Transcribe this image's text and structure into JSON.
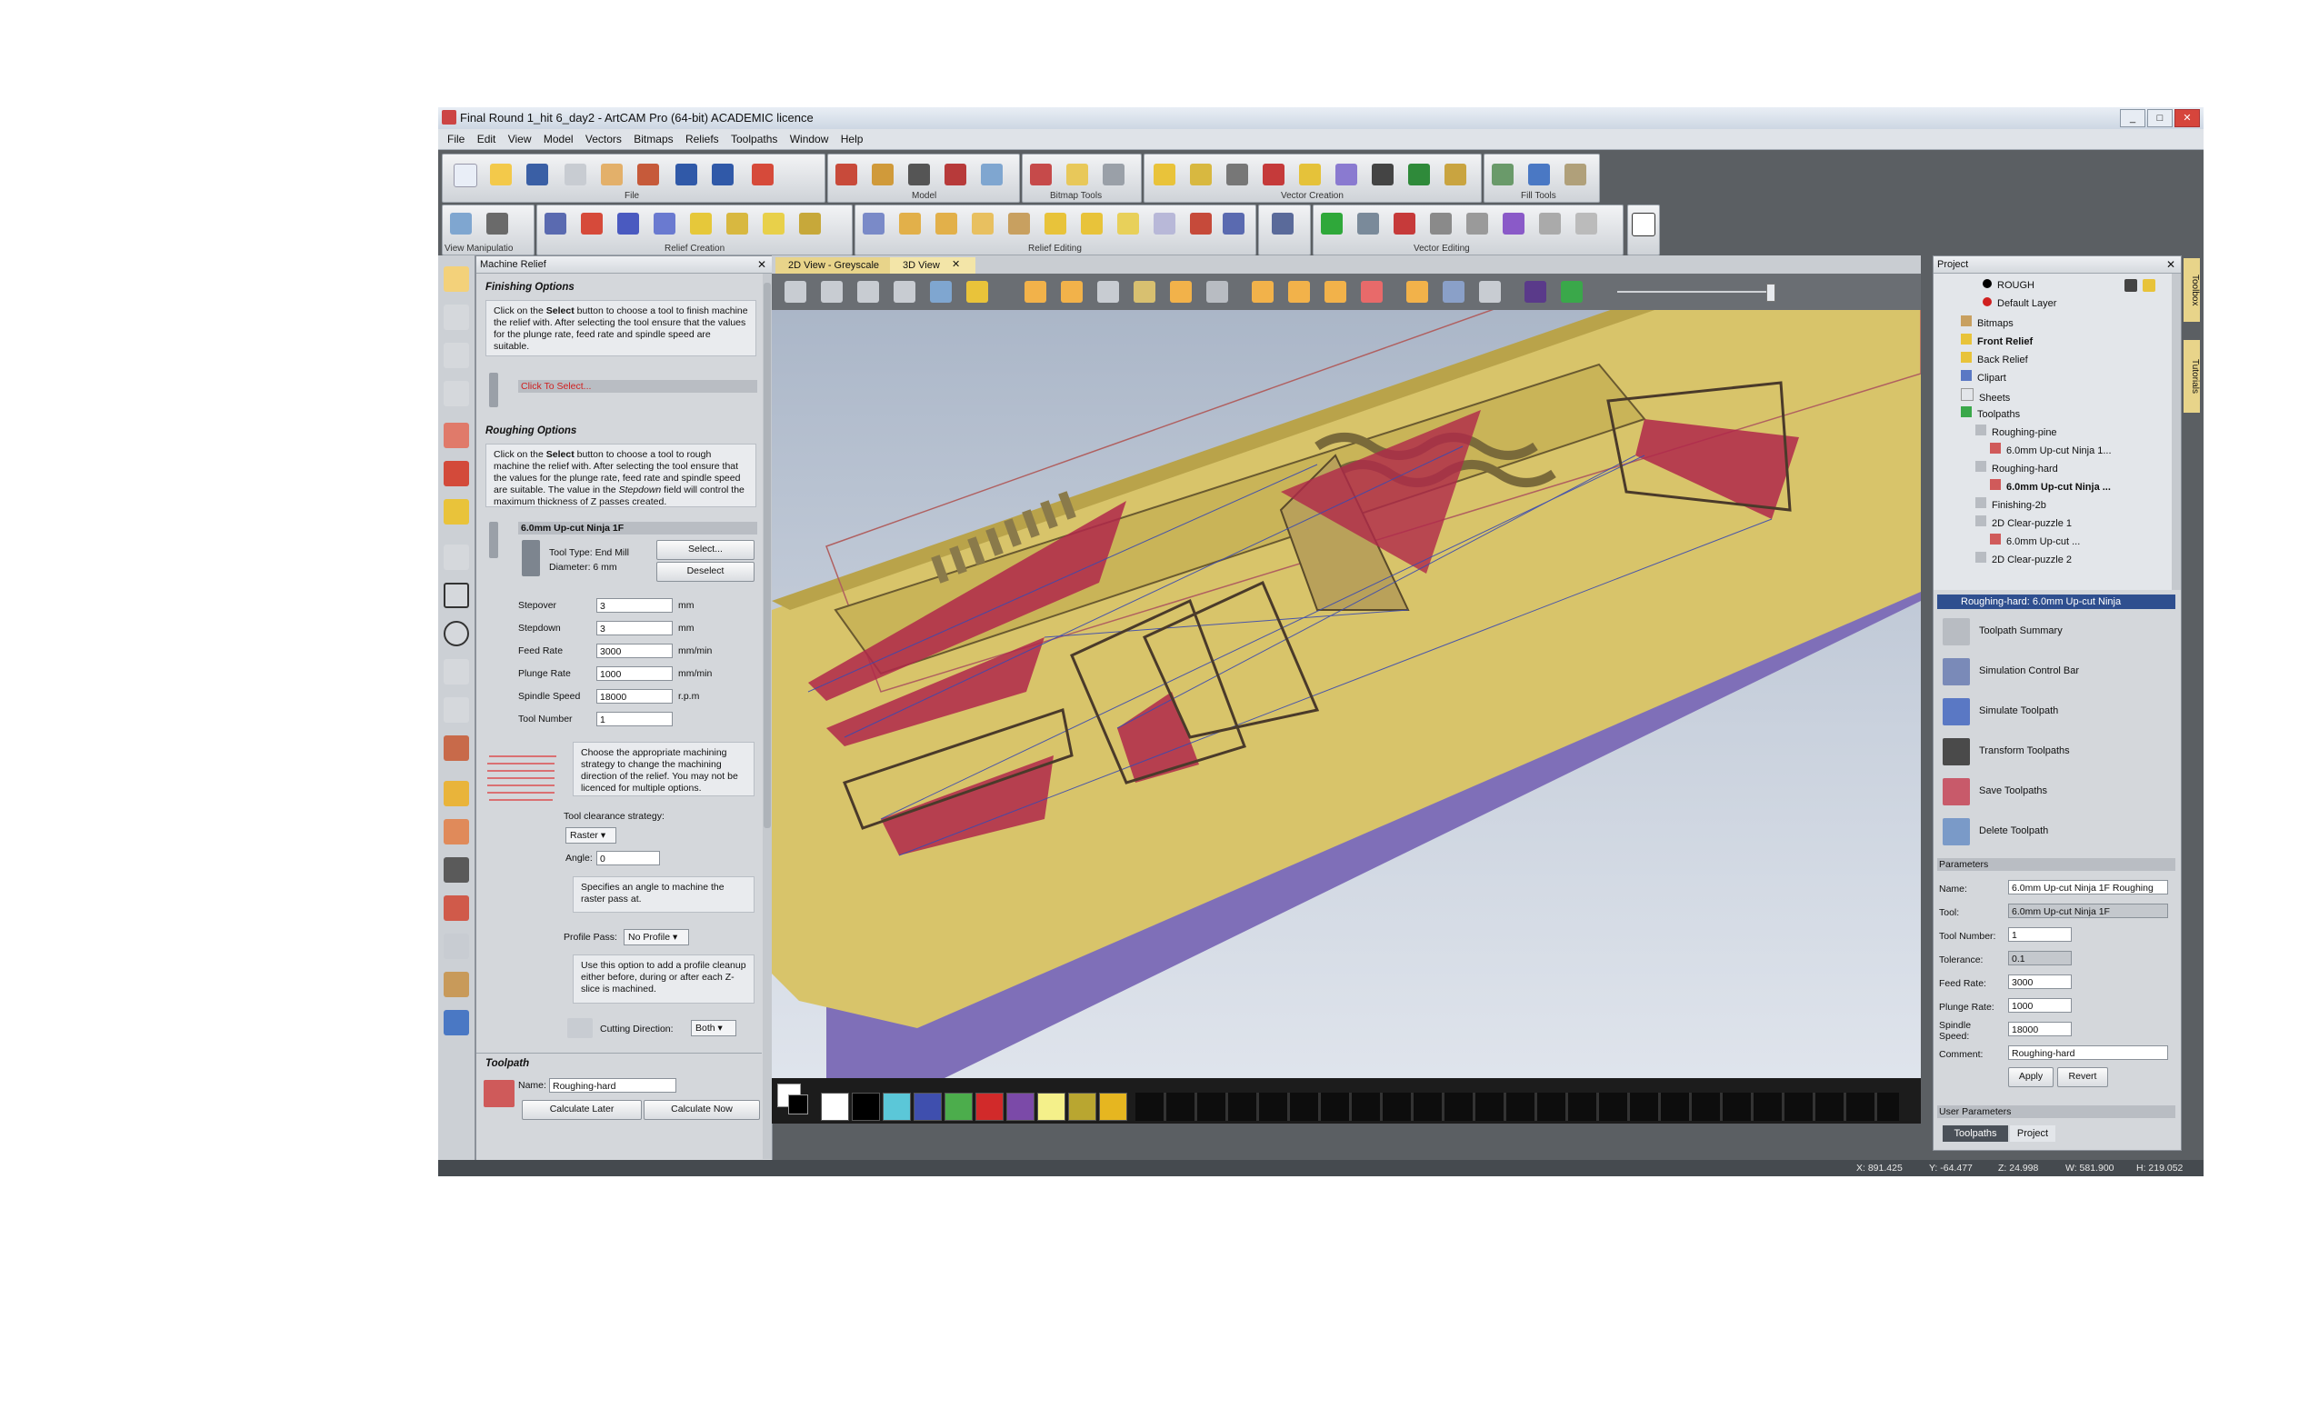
{
  "window": {
    "title": "Final Round 1_hit 6_day2 - ArtCAM Pro (64-bit) ACADEMIC licence"
  },
  "menu": [
    "File",
    "Edit",
    "View",
    "Model",
    "Vectors",
    "Bitmaps",
    "Reliefs",
    "Toolpaths",
    "Window",
    "Help"
  ],
  "toolbars": {
    "row1_captions": [
      "File",
      "Model",
      "Bitmap Tools",
      "Vector Creation",
      "Fill Tools"
    ],
    "row2_captions": [
      "View Manipulatio",
      "Relief Creation",
      "Relief Editing",
      "Vector Editing"
    ]
  },
  "machine_relief": {
    "title": "Machine Relief",
    "finishing_header": "Finishing Options",
    "finishing_info": {
      "pre": "Click on the ",
      "b": "Select",
      "post": " button to choose a tool to finish machine the relief with. After selecting the tool ensure that the values for the plunge rate, feed rate and spindle speed are suitable."
    },
    "finishing_tool": "Click To Select...",
    "roughing_header": "Roughing Options",
    "roughing_info": {
      "pre": "Click on the ",
      "b": "Select",
      "mid": " button to choose a tool to rough machine the relief with. After selecting the tool ensure that the values for the plunge rate, feed rate and spindle speed are suitable. The value in the ",
      "i": "Stepdown",
      "post": " field will control the maximum thickness of Z passes created."
    },
    "tool_name": "6.0mm Up-cut Ninja 1F",
    "tool_type": "Tool Type: End Mill",
    "diameter": "Diameter:  6 mm",
    "select_label": "Select...",
    "deselect_label": "Deselect",
    "params": [
      {
        "label": "Stepover",
        "value": "3",
        "unit": "mm"
      },
      {
        "label": "Stepdown",
        "value": "3",
        "unit": "mm"
      },
      {
        "label": "Feed Rate",
        "value": "3000",
        "unit": "mm/min"
      },
      {
        "label": "Plunge Rate",
        "value": "1000",
        "unit": "mm/min"
      },
      {
        "label": "Spindle Speed",
        "value": "18000",
        "unit": "r.p.m"
      },
      {
        "label": "Tool Number",
        "value": "1",
        "unit": ""
      }
    ],
    "strategy_info": "Choose the appropriate machining strategy to change the machining direction of the relief. You may not be licenced for multiple options.",
    "clearance_label": "Tool clearance strategy:",
    "clearance_value": "Raster",
    "angle_label": "Angle:",
    "angle_value": "0",
    "angle_info": "Specifies an angle to machine the raster pass at.",
    "profile_label": "Profile Pass:",
    "profile_value": "No Profile",
    "profile_info": "Use this option to add a profile cleanup either before, during or after each Z-slice is machined.",
    "cutting_label": "Cutting Direction:",
    "cutting_value": "Both",
    "toolpath_header": "Toolpath",
    "name_label": "Name:",
    "name_value": "Roughing-hard",
    "calc_later": "Calculate Later",
    "calc_now": "Calculate Now"
  },
  "tabs": [
    "2D View - Greyscale",
    "3D View"
  ],
  "palette_colors": [
    "#ffffff",
    "#000000",
    "#5bc7d8",
    "#3f4fae",
    "#4cad4c",
    "#d12a2a",
    "#7b4aa8",
    "#f4f08a",
    "#b9a630",
    "#e6b620"
  ],
  "project": {
    "title": "Project",
    "tree": [
      {
        "label": "ROUGH",
        "indent": 3,
        "bold": false
      },
      {
        "label": "Default Layer",
        "indent": 3,
        "bold": false
      },
      {
        "label": "Bitmaps",
        "indent": 1,
        "bold": false
      },
      {
        "label": "Front Relief",
        "indent": 1,
        "bold": true
      },
      {
        "label": "Back Relief",
        "indent": 1,
        "bold": false
      },
      {
        "label": "Clipart",
        "indent": 1,
        "bold": false
      },
      {
        "label": "Sheets",
        "indent": 1,
        "bold": false
      },
      {
        "label": "Toolpaths",
        "indent": 1,
        "bold": false
      },
      {
        "label": "Roughing-pine",
        "indent": 2,
        "bold": false
      },
      {
        "label": "6.0mm Up-cut Ninja 1...",
        "indent": 3,
        "bold": false
      },
      {
        "label": "Roughing-hard",
        "indent": 2,
        "bold": false
      },
      {
        "label": "6.0mm Up-cut Ninja ...",
        "indent": 3,
        "bold": true
      },
      {
        "label": "Finishing-2b",
        "indent": 2,
        "bold": false
      },
      {
        "label": "2D Clear-puzzle 1",
        "indent": 2,
        "bold": false
      },
      {
        "label": "6.0mm Up-cut ...",
        "indent": 3,
        "bold": false
      },
      {
        "label": "2D Clear-puzzle 2",
        "indent": 2,
        "bold": false
      }
    ],
    "selected_title": "Roughing-hard: 6.0mm Up-cut Ninja",
    "actions": [
      "Toolpath Summary",
      "Simulation Control Bar",
      "Simulate Toolpath",
      "Transform Toolpaths",
      "Save Toolpaths",
      "Delete Toolpath"
    ],
    "params_header": "Parameters",
    "params": [
      {
        "label": "Name:",
        "value": "6.0mm Up-cut Ninja 1F Roughing"
      },
      {
        "label": "Tool:",
        "value": "6.0mm Up-cut Ninja 1F"
      },
      {
        "label": "Tool Number:",
        "value": "1"
      },
      {
        "label": "Tolerance:",
        "value": "0.1"
      },
      {
        "label": "Feed Rate:",
        "value": "3000"
      },
      {
        "label": "Plunge Rate:",
        "value": "1000"
      },
      {
        "label": "Spindle Speed:",
        "value": "18000"
      },
      {
        "label": "Comment:",
        "value": "Roughing-hard"
      }
    ],
    "apply": "Apply",
    "revert": "Revert",
    "user_params": "User Parameters",
    "bottom_tabs": [
      "Toolpaths",
      "Project"
    ]
  },
  "side_tabs": [
    "Toolbox",
    "Tutorials"
  ],
  "status": {
    "x": "X: 891.425",
    "y": "Y: -64.477",
    "z": "Z: 24.998",
    "w": "W: 581.900",
    "h": "H: 219.052"
  }
}
